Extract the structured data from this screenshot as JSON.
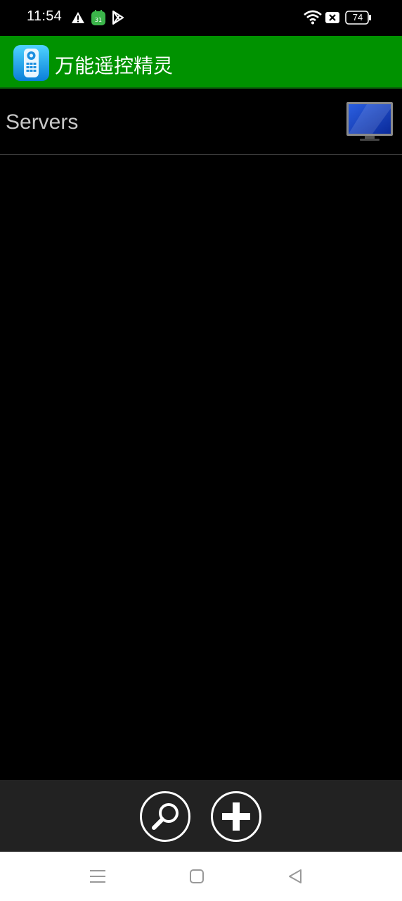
{
  "status_bar": {
    "time": "11:54",
    "battery": "74",
    "icons": [
      "warning-icon",
      "notification-app-icon",
      "play-store-icon",
      "wifi-icon",
      "sim-off-icon",
      "battery-icon"
    ]
  },
  "app_bar": {
    "title": "万能遥控精灵",
    "icon": "remote-control-app-icon",
    "color": "#009200"
  },
  "list_header": {
    "label": "Servers",
    "icon": "monitor-icon"
  },
  "toolbar": {
    "buttons": [
      {
        "name": "search",
        "icon": "search-icon"
      },
      {
        "name": "add",
        "icon": "plus-icon"
      }
    ]
  },
  "nav_bar": {
    "buttons": [
      "menu-icon",
      "home-icon",
      "back-icon"
    ]
  }
}
